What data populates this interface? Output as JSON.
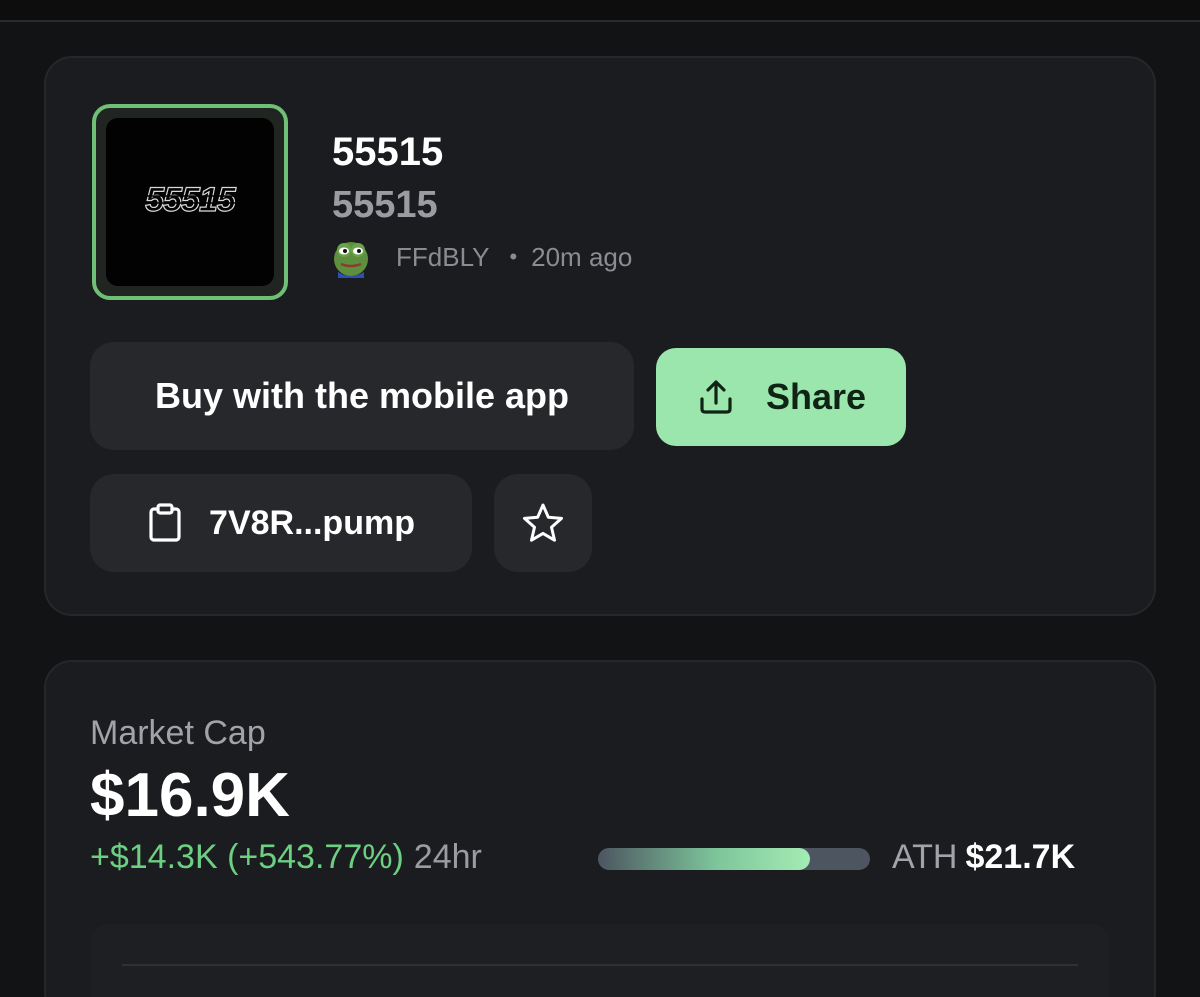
{
  "token": {
    "name": "55515",
    "ticker": "55515",
    "logo_text": "55515",
    "creator": "FFdBLY",
    "separator": "•",
    "created": "20m ago",
    "avatar_icon": "frog-avatar-icon"
  },
  "actions": {
    "buy_label": "Buy with the mobile app",
    "share_label": "Share",
    "share_icon": "share-upload-icon",
    "contract_address": "7V8R...pump",
    "contract_icon": "clipboard-icon",
    "favorite_icon": "star-icon"
  },
  "market": {
    "label": "Market Cap",
    "value": "$16.9K",
    "change": "+$14.3K (+543.77%)",
    "period": "24hr",
    "ath_label": "ATH",
    "ath_value": "$21.7K",
    "ath_progress": 0.78
  },
  "colors": {
    "accent": "#9be6ad",
    "positive": "#6ccf82",
    "background": "#121314",
    "card": "#1b1c1f"
  }
}
